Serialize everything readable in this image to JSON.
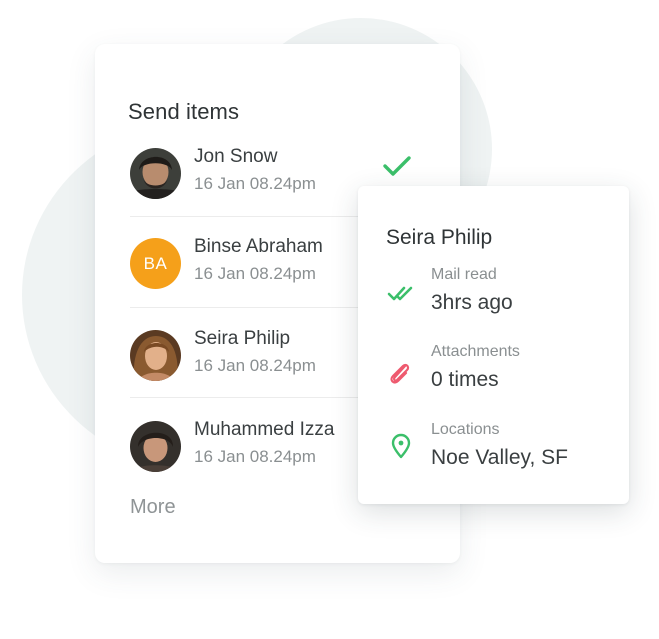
{
  "send_items": {
    "title": "Send items",
    "contacts": [
      {
        "name": "Jon Snow",
        "time": "16 Jan 08.24pm",
        "avatar": "photo"
      },
      {
        "name": "Binse Abraham",
        "time": "16 Jan 08.24pm",
        "avatar": "initials",
        "initials": "BA"
      },
      {
        "name": "Seira Philip",
        "time": "16 Jan 08.24pm",
        "avatar": "photo"
      },
      {
        "name": "Muhammed Izza",
        "time": "16 Jan 08.24pm",
        "avatar": "photo"
      }
    ],
    "more_label": "More",
    "sent_icon": "double-check-icon"
  },
  "details": {
    "name": "Seira Philip",
    "stats": [
      {
        "label": "Mail read",
        "value": "3hrs ago",
        "icon": "double-check-icon",
        "color": "#3bbf6a"
      },
      {
        "label": "Attachments",
        "value": "0 times",
        "icon": "paperclip-icon",
        "color": "#ee5a6f"
      },
      {
        "label": "Locations",
        "value": "Noe Valley, SF",
        "icon": "location-pin-icon",
        "color": "#3bbf6a"
      }
    ]
  },
  "colors": {
    "accent_green": "#3bbf6a",
    "accent_red": "#ee5a6f",
    "initials_avatar": "#f5a01a",
    "background_blob": "#eff3f3"
  }
}
